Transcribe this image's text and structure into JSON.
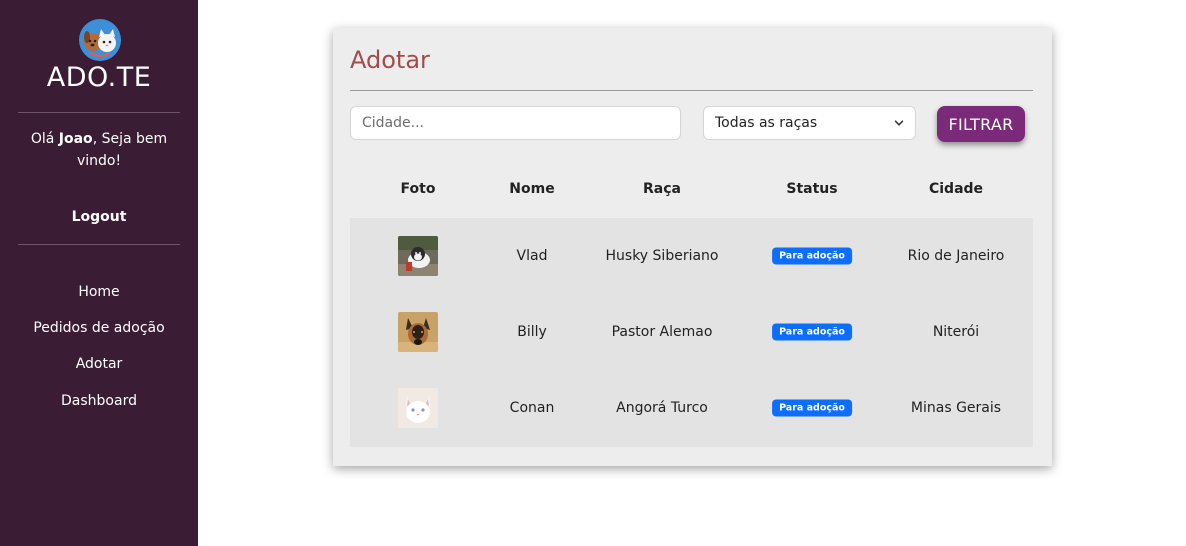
{
  "sidebar": {
    "brand": "ADO.TE",
    "greeting_prefix": "Olá ",
    "user_name": "Joao",
    "greeting_suffix": ", Seja bem vindo!",
    "logout": "Logout",
    "nav": [
      "Home",
      "Pedidos de adoção",
      "Adotar",
      "Dashboard"
    ]
  },
  "main": {
    "title": "Adotar",
    "city_placeholder": "Cidade...",
    "breed_select": "Todas as raças",
    "filter_button": "FILTRAR",
    "columns": [
      "Foto",
      "Nome",
      "Raça",
      "Status",
      "Cidade"
    ],
    "rows": [
      {
        "photo": "husky-puppy-photo",
        "name": "Vlad",
        "breed": "Husky Siberiano",
        "status": "Para adoção",
        "city": "Rio de Janeiro"
      },
      {
        "photo": "german-shepherd-photo",
        "name": "Billy",
        "breed": "Pastor Alemao",
        "status": "Para adoção",
        "city": "Niterói"
      },
      {
        "photo": "white-cat-photo",
        "name": "Conan",
        "breed": "Angorá Turco",
        "status": "Para adoção",
        "city": "Minas Gerais"
      }
    ]
  },
  "colors": {
    "sidebar_bg": "#3a1c35",
    "title": "#a34a4a",
    "filter_button": "#7a2a79",
    "badge": "#0d6efd"
  }
}
